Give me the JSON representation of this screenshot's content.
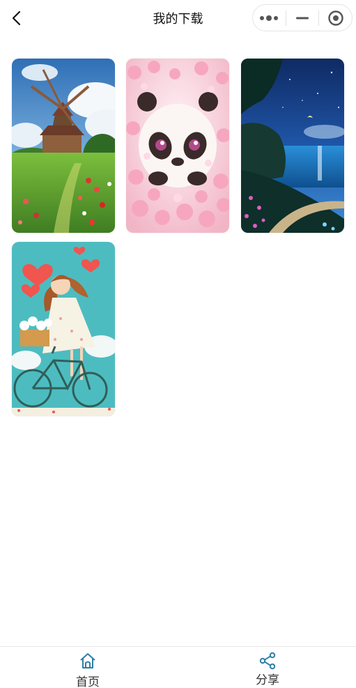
{
  "header": {
    "title": "我的下载",
    "back_icon": "chevron-left-icon",
    "capsule": {
      "menu_icon": "more-dots-icon",
      "minimize_icon": "minimize-icon",
      "close_icon": "target-circle-icon"
    }
  },
  "wallpapers": [
    {
      "subject": "windmill-landscape",
      "colors": {
        "sky": "#3d7fc4",
        "grass": "#4f9a2f"
      }
    },
    {
      "subject": "panda-cherry-blossom",
      "colors": {
        "bg": "#f6c9d6",
        "panda": "#3a2a2a"
      }
    },
    {
      "subject": "night-coast",
      "colors": {
        "sky": "#16408c",
        "sea": "#1f6fb8"
      }
    },
    {
      "subject": "girl-on-bicycle",
      "colors": {
        "bg": "#4dbcc0",
        "heart": "#f0554e"
      }
    }
  ],
  "tabbar": {
    "items": [
      {
        "label": "首页",
        "icon": "home-icon",
        "active": true
      },
      {
        "label": "分享",
        "icon": "share-icon",
        "active": false
      }
    ],
    "active_color": "#2e7fa8"
  }
}
